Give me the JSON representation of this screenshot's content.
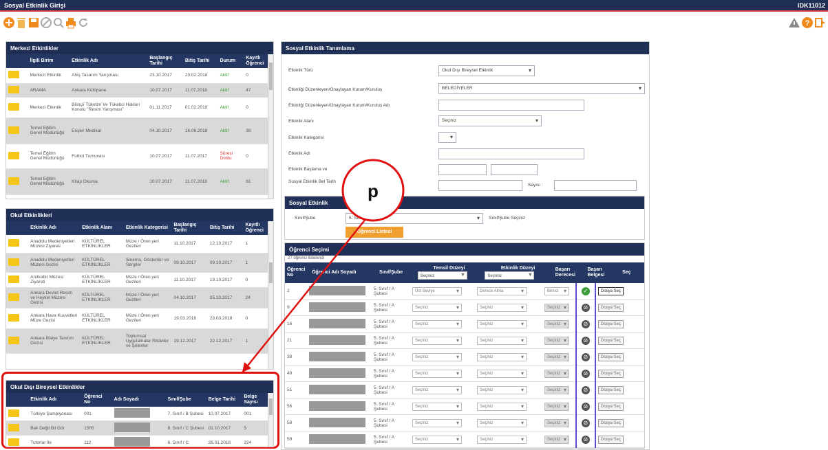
{
  "window": {
    "title": "Sosyal Etkinlik Girişi",
    "code": "IDK11012"
  },
  "merkezi": {
    "title": "Merkezi Etkinlikler",
    "headers": [
      "İlgili Birim",
      "Etkinlik Adı",
      "Başlangıç Tarihi",
      "Bitiş Tarihi",
      "Durum",
      "Kayıtlı Öğrenci"
    ],
    "rows": [
      [
        "Merkezi Etkinlik",
        "Ahiş Tasarım Yarışması",
        "23.10.2017",
        "23.02.2018",
        "Aktif",
        "0"
      ],
      [
        "ARAMA",
        "Ankara Kütüpane",
        "10.07.2017",
        "11.07.2018",
        "Aktif",
        "47"
      ],
      [
        "Merkezi Etkinlik",
        "Bilinçli Tüketim Ve Tüketici Hakları Konulu \"Resim Yarışması\"",
        "01.11.2017",
        "01.02.2018",
        "Aktif",
        "0"
      ],
      [
        "Temel Eğitim Genel Müdürlüğü",
        "Erişler Medikal",
        "04.10.2017",
        "16.06.2018",
        "Aktif",
        "38"
      ],
      [
        "Temel Eğitim Genel Müdürlüğü",
        "Futbol Turnuvası",
        "10.07.2017",
        "11.07.2017",
        "Süresi Doldu",
        "0"
      ],
      [
        "Temel Eğitim Genel Müdürlüğü",
        "Kitap Okuma",
        "10.07.2017",
        "11.07.2018",
        "Aktif",
        "61"
      ]
    ]
  },
  "okul": {
    "title": "Okul Etkinlikleri",
    "headers": [
      "Etkinlik Adı",
      "Etkinlik Alanı",
      "Etkinlik Kategorisi",
      "Başlangıç Tarihi",
      "Bitiş Tarihi",
      "Kayıtlı Öğrenci"
    ],
    "rows": [
      [
        "Anadolu Medeniyetleri Müzesi Ziyareti",
        "KÜLTÜREL ETKİNLİKLER",
        "Müze / Ören yeri Gezileri",
        "11.10.2017",
        "12.10.2017",
        "1"
      ],
      [
        "Anadolu Medeniyetleri Müzesi Gezisi",
        "KÜLTÜREL ETKİNLİKLER",
        "Sinema, Gösteriler ve Sergiler",
        "09.10.2017",
        "09.10.2017",
        "1"
      ],
      [
        "Anıtkabir Müzesi Ziyareti",
        "KÜLTÜREL ETKİNLİKLER",
        "Müze / Ören yeri Gezileri",
        "11.10.2017",
        "19.10.2017",
        "0"
      ],
      [
        "Ankara Devlet Resim ve Heykel Müzesi Gezisi",
        "KÜLTÜREL ETKİNLİKLER",
        "Müze / Ören yeri Gezileri",
        "04.10.2017",
        "05.10.2017",
        "24"
      ],
      [
        "Ankara Hava Kuvvetleri Müze Gezisi",
        "KÜLTÜREL ETKİNLİKLER",
        "Müze / Ören yeri Gezileri",
        "19.03.2018",
        "23.03.2018",
        "0"
      ],
      [
        "Ankara İtfaiye Tanıtım Gezisi",
        "KÜLTÜREL ETKİNLİKLER",
        "Toplumsal Uygulamalar Ritüeller ve Şölenler",
        "19.12.2017",
        "22.12.2017",
        "1"
      ]
    ]
  },
  "disi": {
    "title": "Okul Dışı Bireysel Etkinlikler",
    "headers": [
      "Etkinlik Adı",
      "Öğrenci No",
      "Adı Soyadı",
      "Sınıf/Şube",
      "Belge Tarihi",
      "Belge Sayısı"
    ],
    "rows": [
      [
        "Türkiye Şampiyonası",
        "001",
        "",
        "7. Sınıf / B Şubesi",
        "10.07.2017",
        "001"
      ],
      [
        "Bak Değil Bil Gör",
        "1505",
        "",
        "8. Sınıf / C Şubesi",
        "01.10.2017",
        "5"
      ],
      [
        "Tutorlar İle",
        "112",
        "",
        "6. Sınıf / C",
        "26.01.2018",
        "224"
      ]
    ]
  },
  "tanimlama": {
    "title": "Sosyal Etkinlik Tanımlama",
    "labels": [
      "Etkinlik Türü",
      "Etkinliği Düzenleyen/Onaylayan Kurum/Kuruluş",
      "Etkinliği Düzenleyen/Onaylayan Kurum/Kuruluş Adı",
      "Etkinlik Alanı",
      "Etkinlik Kategorisi",
      "Etkinlik Adı",
      "Etkinlik Başlama ve",
      "Sosyal Etkinlik Bel Tarih"
    ],
    "tur_value": "Okul Dışı Bireysel Etkinlik",
    "kurum_value": "BELEDİYELER",
    "alan_value": "Seçiniz",
    "sayisi_label": "Sayısı :"
  },
  "sube_panel": {
    "title": "Sosyal Etkinlik",
    "label": "Sınıf/Şube",
    "select_value": "5. Sınıf / A Şubesi",
    "hint": "Sınıf/Şube Seçiniz",
    "button": "Öğrenci Listesi"
  },
  "ogrenci": {
    "title": "Öğrenci Seçimi",
    "count": "27 öğrenci listelendi",
    "headers": [
      "Öğrenci No",
      "Öğrenci Adı Soyadı",
      "Sınıf/Şube",
      "Temsil Düzeyi",
      "Etkinlik Düzeyi",
      "Başarı Derecesi",
      "Başarı Belgesi",
      "Seç"
    ],
    "temsil_default": "Seçiniz",
    "etkinlik_default": "Seçiniz",
    "rows": [
      {
        "no": "2",
        "sube": "5. Sınıf / A Şubesi",
        "temsil": "Üst Seviye",
        "etkinlik": "Derece Alma",
        "derece": "Birinci",
        "ok": true,
        "btn": "Dosya Seç"
      },
      {
        "no": "9",
        "sube": "5. Sınıf / A Şubesi",
        "temsil": "Seçiniz",
        "etkinlik": "Seçiniz",
        "derece": "Seçiniz",
        "ok": false,
        "btn": "Dosya Seç"
      },
      {
        "no": "16",
        "sube": "5. Sınıf / A Şubesi",
        "temsil": "Seçiniz",
        "etkinlik": "Seçiniz",
        "derece": "Seçiniz",
        "ok": false,
        "btn": "Dosya Seç"
      },
      {
        "no": "21",
        "sube": "5. Sınıf / A Şubesi",
        "temsil": "Seçiniz",
        "etkinlik": "Seçiniz",
        "derece": "Seçiniz",
        "ok": false,
        "btn": "Dosya Seç"
      },
      {
        "no": "38",
        "sube": "5. Sınıf / A Şubesi",
        "temsil": "Seçiniz",
        "etkinlik": "Seçiniz",
        "derece": "Seçiniz",
        "ok": false,
        "btn": "Dosya Seç"
      },
      {
        "no": "49",
        "sube": "5. Sınıf / A Şubesi",
        "temsil": "Seçiniz",
        "etkinlik": "Seçiniz",
        "derece": "Seçiniz",
        "ok": false,
        "btn": "Dosya Seç"
      },
      {
        "no": "51",
        "sube": "5. Sınıf / A Şubesi",
        "temsil": "Seçiniz",
        "etkinlik": "Seçiniz",
        "derece": "Seçiniz",
        "ok": false,
        "btn": "Dosya Seç"
      },
      {
        "no": "56",
        "sube": "5. Sınıf / A Şubesi",
        "temsil": "Seçiniz",
        "etkinlik": "Seçiniz",
        "derece": "Seçiniz",
        "ok": false,
        "btn": "Dosya Seç"
      },
      {
        "no": "58",
        "sube": "5. Sınıf / A Şubesi",
        "temsil": "Seçiniz",
        "etkinlik": "Seçiniz",
        "derece": "Seçiniz",
        "ok": false,
        "btn": "Dosya Seç"
      },
      {
        "no": "59",
        "sube": "5. Sınıf / A Şubesi",
        "temsil": "Seçiniz",
        "etkinlik": "Seçiniz",
        "derece": "Seçiniz",
        "ok": false,
        "btn": "Dosya Seç"
      }
    ]
  },
  "annotation": {
    "label": "p",
    "color": "#e01010"
  },
  "colors": {
    "header": "#1f2f55",
    "accent": "#f0a030",
    "annotation": "#e01010"
  },
  "icons": [
    "add-icon",
    "delete-icon",
    "save-icon",
    "cancel-icon",
    "search-icon",
    "print-icon",
    "refresh-icon",
    "warning-icon",
    "help-icon",
    "exit-icon"
  ]
}
